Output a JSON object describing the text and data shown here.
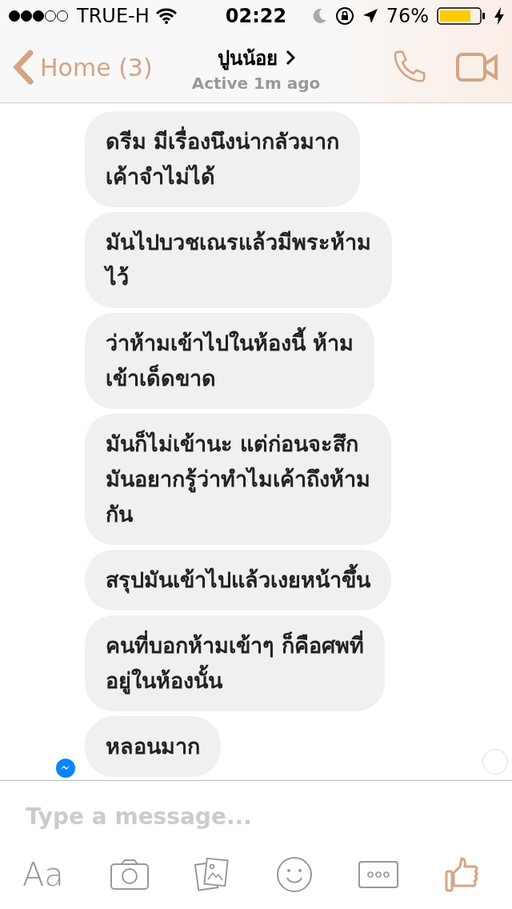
{
  "status_bar": {
    "carrier": "TRUE-H",
    "time": "02:22",
    "battery": "76%"
  },
  "header": {
    "back": "Home (3)",
    "name": "ปูนน้อย",
    "status": "Active 1m ago"
  },
  "messages": [
    {
      "lines": [
        "ดรีม มีเรื่องนึงน่ากลัวมาก",
        "เค้าจำไม่ได้"
      ]
    },
    {
      "lines": [
        "มันไปบวชเณรแล้วมีพระห้าม",
        "ไว้"
      ]
    },
    {
      "lines": [
        "ว่าห้ามเข้าไปในห้องนี้ ห้าม",
        "เข้าเด็ดขาด"
      ]
    },
    {
      "lines": [
        "มันก็ไม่เข้านะ แต่ก่อนจะสึก",
        "มันอยากรู้ว่าทำไมเค้าถึงห้าม",
        "กัน"
      ]
    },
    {
      "lines": [
        "สรุปมันเข้าไปแล้วเงยหน้าขึ้น"
      ]
    },
    {
      "lines": [
        "คนที่บอกห้ามเข้าๆ ก็คือศพที่",
        "อยู่ในห้องนั้น"
      ]
    },
    {
      "lines": [
        "หลอนมาก"
      ]
    }
  ],
  "composer": {
    "placeholder": "Type a message...",
    "text_button": "Aa"
  }
}
